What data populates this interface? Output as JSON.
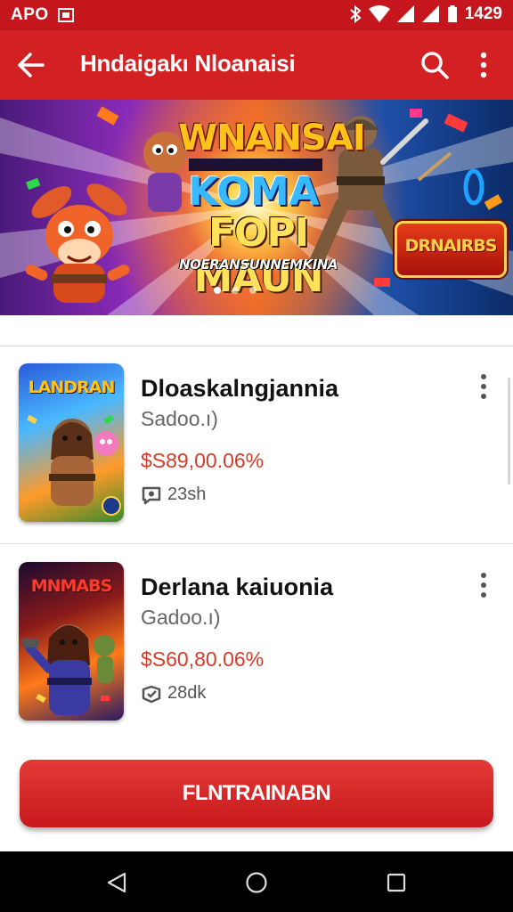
{
  "status_bar": {
    "left_text": "APO",
    "time": "1429"
  },
  "app_bar": {
    "title": "Hndaigakı Nloanaisi"
  },
  "banner": {
    "line1": "WNANSAI",
    "line2": "KOMA",
    "line3": "FOPI MAUN",
    "line4": "NOERANSUNNEMKINA",
    "badge": "DRNAIRBS"
  },
  "items": [
    {
      "thumb_title": "LANDRAN",
      "title": "Dloaskalngjannia",
      "subtitle": "Sadoo.ı)",
      "price": "$S89,00.06%",
      "meta": "23sh"
    },
    {
      "thumb_title": "MNMABS",
      "title": "Derlana kaiuonia",
      "subtitle": "Gadoo.ı)",
      "price": "$S60,80.06%",
      "meta": "28dk"
    }
  ],
  "cta": {
    "label": "FLNTRAINABN"
  },
  "colors": {
    "primary": "#d32023",
    "status_bar": "#c4161c",
    "price": "#d63a2a"
  }
}
